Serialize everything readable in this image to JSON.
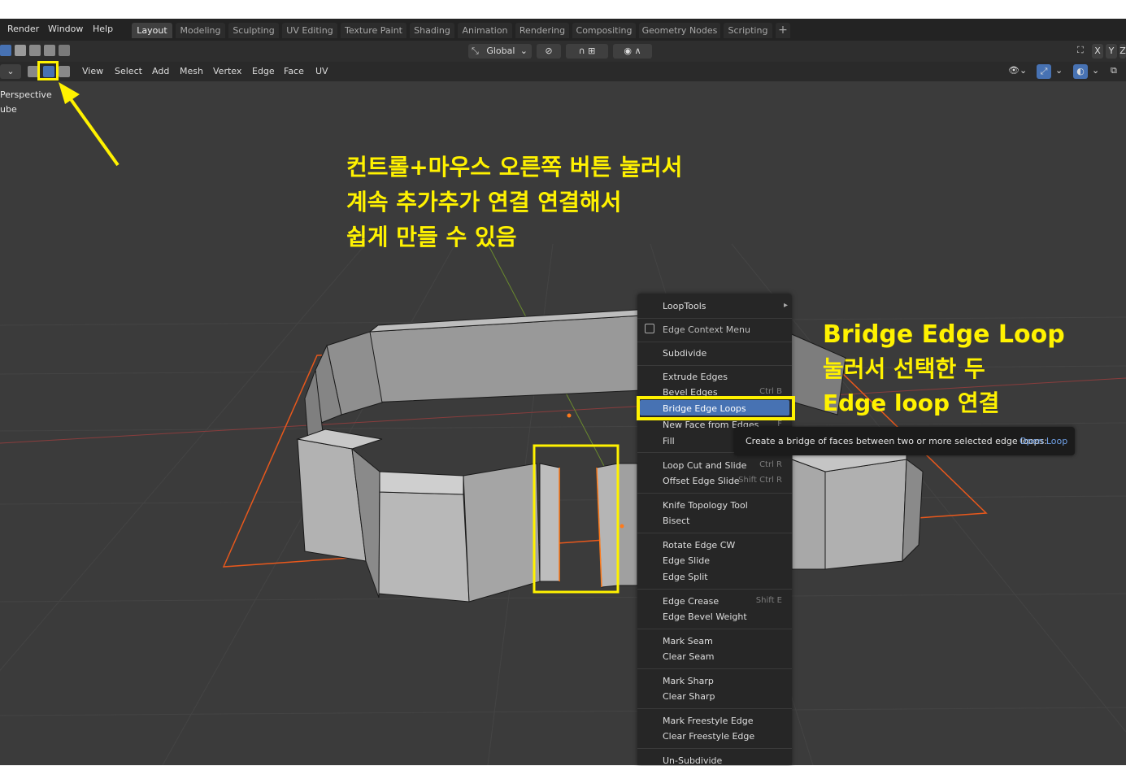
{
  "menubar": {
    "items": [
      "Render",
      "Window",
      "Help"
    ],
    "tabs": [
      "Layout",
      "Modeling",
      "Sculpting",
      "UV Editing",
      "Texture Paint",
      "Shading",
      "Animation",
      "Rendering",
      "Compositing",
      "Geometry Nodes",
      "Scripting"
    ],
    "active_tab": "Layout",
    "add_tab": "+"
  },
  "toolrow": {
    "orientation": "Global",
    "axis_x": "X",
    "axis_y": "Y",
    "axis_z": "Z"
  },
  "header": {
    "menus": [
      "View",
      "Select",
      "Add",
      "Mesh",
      "Vertex",
      "Edge",
      "Face",
      "UV"
    ]
  },
  "viewport": {
    "view_name": "Perspective",
    "object_name": "ube"
  },
  "annotations": {
    "korean_lines": [
      "컨트롤+마우스 오른쪽 버튼 눌러서",
      "계속 추가추가 연결 연결해서",
      "쉽게 만들 수 있음"
    ],
    "right_lines": [
      "Bridge Edge Loop",
      "눌러서 선택한 두",
      "Edge loop 연결"
    ]
  },
  "context_menu": {
    "items": [
      {
        "label": "LoopTools",
        "shortcut": "▸"
      },
      {
        "label": "Edge Context Menu",
        "shortcut": ""
      },
      {
        "label": "Subdivide",
        "shortcut": ""
      },
      {
        "label": "Extrude Edges",
        "shortcut": ""
      },
      {
        "label": "Bevel Edges",
        "shortcut": "Ctrl B"
      },
      {
        "label": "Bridge Edge Loops",
        "shortcut": ""
      },
      {
        "label": "New Face from Edges",
        "shortcut": "F"
      },
      {
        "label": "Fill",
        "shortcut": ""
      },
      {
        "label": "Loop Cut and Slide",
        "shortcut": "Ctrl R"
      },
      {
        "label": "Offset Edge Slide",
        "shortcut": "Shift Ctrl R"
      },
      {
        "label": "Knife Topology Tool",
        "shortcut": ""
      },
      {
        "label": "Bisect",
        "shortcut": ""
      },
      {
        "label": "Rotate Edge CW",
        "shortcut": ""
      },
      {
        "label": "Edge Slide",
        "shortcut": ""
      },
      {
        "label": "Edge Split",
        "shortcut": ""
      },
      {
        "label": "Edge Crease",
        "shortcut": "Shift E"
      },
      {
        "label": "Edge Bevel Weight",
        "shortcut": ""
      },
      {
        "label": "Mark Seam",
        "shortcut": ""
      },
      {
        "label": "Clear Seam",
        "shortcut": ""
      },
      {
        "label": "Mark Sharp",
        "shortcut": ""
      },
      {
        "label": "Clear Sharp",
        "shortcut": ""
      },
      {
        "label": "Mark Freestyle Edge",
        "shortcut": ""
      },
      {
        "label": "Clear Freestyle Edge",
        "shortcut": ""
      },
      {
        "label": "Un-Subdivide",
        "shortcut": ""
      }
    ],
    "highlighted": "Bridge Edge Loops"
  },
  "tooltip": {
    "text": "Create a bridge of faces between two or more selected edge loops:",
    "value": "Open Loop"
  },
  "colors": {
    "accent_blue": "#4772b3",
    "annotation_yellow": "#fff200",
    "selection_orange": "#ff7a1a",
    "tooltip_link": "#6fa0e6"
  }
}
